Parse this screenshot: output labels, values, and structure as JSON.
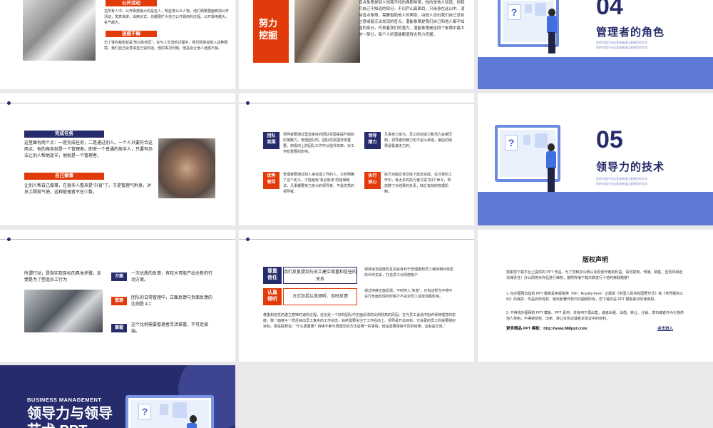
{
  "slide1": {
    "tag_public": "公开活动",
    "text_public": "在所有人中，公开靠搜最大的是名人，明星等公众人物。他们频繁露面参加公开活动，发表演讲、出席仪式，也都展扩大自己公开靠用的过程。公开靠用越大，名气越大。",
    "tag_mystery": "迷惑不解",
    "text_mystery": "忘了谁的秘密就是“知识的盲区”，在与人交流的过程中，我们经常会陷入这种困境。我们自己会觉得自己说的话，他的事况问题。但是会让他人迷惑不解。"
  },
  "slide2": {
    "tag": "努力挖掘",
    "text": "盲点象限是别人知我不知的弗朗地带，他的是他人知道，但我们自己不知道的部分。不识庐山真面目，只缘身在此山中。消除盲点象限，需要借助他人的帮助，由他人说出我们自己没有注意或者无法发现的盲点。潜能象限是我们自己和他人都不知道的部分，代表着我们的潜力。潜能象限是这四个象限中最大的一部分，每个人的潜能都值得去努力挖掘。"
  },
  "slide3": {
    "num": "04",
    "title": "管理者的角色",
    "sub1": "您的内容打在这里或者通过复制您的文本",
    "sub2": "您的内容打在这里或者通过复制您的文本"
  },
  "slide4": {
    "tag_task": "完成任务",
    "text_task": "这里面有两个点：一是完成任务，二是通过别人。一个人只要符合这两点，他的角色就是一个管理者。即使一个普通的放羊人，只要有办法让别人帮他放羊，他就是一个管理者。",
    "tag_self": "自己做事",
    "text_self": "让别人帮自己做事，在很多人看来是“升官”了。于是管理气附身，对员工颐指气使。这种管理者不在少数。"
  },
  "slide5": {
    "items": [
      {
        "label": "团队\n氛围",
        "text": "领导者要通过营造良好的团队氛围来提升组织的凝聚力，管理团队时，团队的氛围非常重要。积极向上的团队工作可以提升效率，对工作有重要的影响。"
      },
      {
        "label": "领导\n精力",
        "text": "凡事亲力亲为，员工的创造力和活力会被压制。领导者的精力也不足以承担，最后的结果是极其无力的。"
      },
      {
        "label": "优秀\n领导",
        "text": "管理者要通过别人来完成工作的人。只有明确了这个定义，才能避免“事必躬亲”的错误做法。凡事都要亲力亲为的领导者，不是优秀的领导者。"
      },
      {
        "label": "执行\n核心",
        "text": "执行功能应该交给下属去完成，在日常的工作中，有太多的执行者只是“执行”命令，却忽略了对结果的负责，缺乏有效的管理机制。"
      }
    ]
  },
  "slide6": {
    "num": "05",
    "title": "领导力的技术",
    "sub1": "您的内容打在这里或者通过复制您的文本",
    "sub2": "您的内容打在这里或者通过复制您的文本"
  },
  "slide7": {
    "intro": "所谓行动，是指实现目标的具体步骤。反馈是为了塑造员工行为",
    "items": [
      {
        "label": "方案",
        "text": "一次优质的反馈，有较大可能产出全新的行动方案。"
      },
      {
        "label": "管理",
        "text": "团队的日常管理中，正面反馈与负面反馈的比例是 4:1"
      },
      {
        "label": "掌握",
        "text": "这个比例需要管理者灵活掌握，不可走极端。"
      }
    ]
  },
  "slide8": {
    "row1_label": "尊重\n信任",
    "row1_box": "我们反复提到与员工建立尊重和信任的关系",
    "row1_text": "保持适当强度的互动会有利于管理者和员工保持相对亲密的伙伴关系，打造员工对情感账户",
    "row2_label": "认真\n倾听",
    "row2_box": "方式包括认真倾听、及时反馈",
    "row2_text": "通过持续正面反馈，不时存入“资金”，只有这样当不得不进行负面反馈的时候才不会对员工造成消极影响。",
    "bottom_text": "尊重和信任的建立意味时速的过程，这也是一个好的团队中正面反馈的比例较高的原因。在与员工谈话中始终保持理性的态度，像一面镜子一样反映出员工真实的工作状态，始终需要关注于工作后动上。领导是开总目标。它会蒙的员工的操要组织目标。那是联想说：“什么更重要？持续不断与周围交的方法是唯一的事情，但是需要保持不同的结果，这就是交流。”"
  },
  "slide9": {
    "title": "版权声明",
    "para1": "感谢您下载平台上提供的 PPT 作品，为了您和办公网以及原创作者的利益，请勿复制、传播、销售，否则将承担法律责任！办公网将对作品进行维权，按照传播下载次数进行十倍的索取赔偿！",
    "para2": "1. 在办图网出售的 PPT 模板是免版税类（RF：Royalty-Free）正版受《中国人民共和国著作法》和《世界版权公约》的保护，作品的所有权、版权和著作权归办图网所有，您下载的是 PPT 模板素材的使用权。",
    "para3": "2. 不得将办图网的 PPT 模板、PPT 素材，本身用于再出售，或者出租、出借、转让、分销、发布或者作为礼物供他人使用，不得转授权、出卖、转让本协议或者本协议中的权利。",
    "more_label": "更多精品 PPT 模板：",
    "more_url": "http://www.888ppt.com/",
    "enter": "点击进入"
  },
  "slide10": {
    "eyebrow": "BUSINESS MANAGEMENT",
    "title": "领导力与领导",
    "title2": "艺术 PPT"
  },
  "colors": {
    "navy": "#262b6b",
    "red": "#e23b0b",
    "blue": "#5d7bd6"
  }
}
